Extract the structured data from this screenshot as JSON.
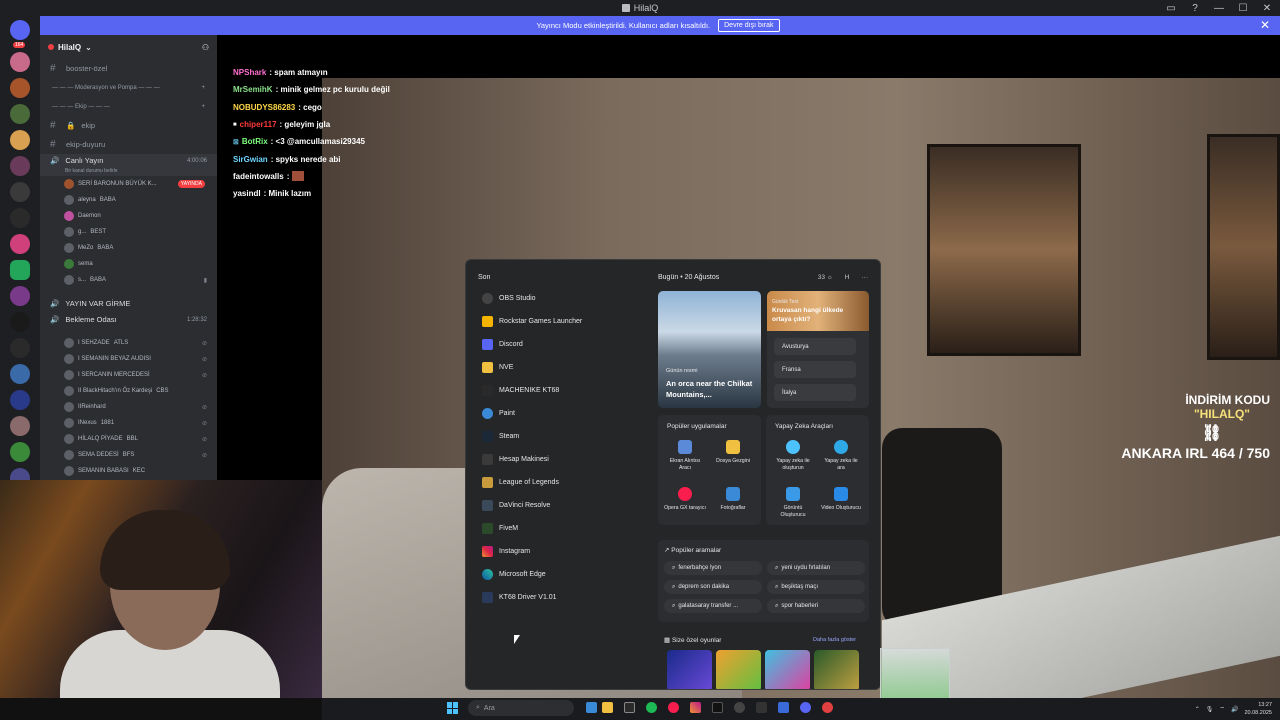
{
  "window": {
    "title": "HilalQ",
    "controls": [
      "▭",
      "?",
      "—",
      "☐",
      "✕"
    ]
  },
  "banner": {
    "text": "Yayıncı Modu etkinleştirildi. Kullanıcı adları kısaltıldı.",
    "button": "Devre dışı bırak"
  },
  "rail": {
    "badge": "164"
  },
  "sidebar": {
    "server_name": "HilalQ",
    "channels": [
      {
        "label": "booster-özel"
      }
    ],
    "cat_moderation": "Moderasyon ve Pompa",
    "cat_ekip": "Ekip",
    "ekip_channels": [
      "ekip",
      "ekip-duyuru"
    ],
    "voice1": {
      "name": "Canlı Yayın",
      "time": "4:00:06",
      "sub": "Bir kanal durumu belirle"
    },
    "voice1_users": [
      {
        "name": "SERİ BARONUN BÜYÜK K...",
        "tag": "YAYINDA"
      },
      {
        "name": "aleyna",
        "badge": "BABA"
      },
      {
        "name": "Daemon",
        "badge": ""
      },
      {
        "name": "g...",
        "badge": "BEST"
      },
      {
        "name": "MeZo",
        "badge": "BABA"
      },
      {
        "name": "sema",
        "badge": ""
      },
      {
        "name": "s...",
        "badge": "BABA"
      }
    ],
    "cat_yayin": "YAYIN VAR GİRME",
    "voice2": {
      "name": "Bekleme Odası",
      "time": "1:28:32"
    },
    "voice2_users": [
      {
        "name": "I SEHZADE",
        "badge": "ATLS"
      },
      {
        "name": "I SEMANIN BEYAZ AUDISI",
        "badge": ""
      },
      {
        "name": "I SERCANIN MERCEDESİ",
        "badge": ""
      },
      {
        "name": "II BlackHitach'ın Öz Kardeşi",
        "badge": "CBS"
      },
      {
        "name": "IIReinhard",
        "badge": ""
      },
      {
        "name": "INexus",
        "badge": "1881"
      },
      {
        "name": "HİLALQ PİYADE",
        "badge": "BBL"
      },
      {
        "name": "SEMA DEDESİ",
        "badge": "BFS"
      },
      {
        "name": "SEMANIN BABASI",
        "badge": "KEC"
      }
    ]
  },
  "chat": [
    {
      "user": "NPShark",
      "color": "#ff6fcf",
      "msg": ": spam atmayın"
    },
    {
      "user": "MrSemihK",
      "color": "#8be28b",
      "msg": ": minik gelmez pc kurulu değil"
    },
    {
      "user": "NOBUDYS86283",
      "color": "#ffd84a",
      "msg": ": cego"
    },
    {
      "user": "chiper117",
      "color": "#ff3b3b",
      "msg": ": geleyim jgla"
    },
    {
      "user": "BotRix",
      "color": "#7dff7d",
      "msg": ": <3 @amcullamasi29345"
    },
    {
      "user": "SirGwian",
      "color": "#6fd6ff",
      "msg": ": spyks nerede abi"
    },
    {
      "user": "fadeintowalls",
      "color": "#ffffff",
      "msg": ":"
    },
    {
      "user": "yasindl",
      "color": "#ffffff",
      "msg": ": Minik lazım"
    }
  ],
  "promo": {
    "line1": "İNDİRİM KODU",
    "line2": "\"HILALQ\"",
    "line3": "ANKARA IRL 464 / 750"
  },
  "start_menu": {
    "recent_header": "Son",
    "apps": [
      "OBS Studio",
      "Rockstar Games Launcher",
      "Discord",
      "NVE",
      "MACHENIKE KT68",
      "Paint",
      "Steam",
      "Hesap Makinesi",
      "League of Legends",
      "DaVinci Resolve",
      "FiveM",
      "Instagram",
      "Microsoft Edge",
      "KT68 Driver V1.01"
    ],
    "today": "Bugün",
    "date": "20 Ağustos",
    "weather": "33",
    "user_initial": "H",
    "photo_label": "Günün resmi",
    "photo_title": "An orca near the Chilkat Mountains,...",
    "quiz_tag": "Günlük Test",
    "quiz_question": "Kruvasan hangi ülkede ortaya çıktı?",
    "quiz_options": [
      "Avusturya",
      "Fransa",
      "İtalya"
    ],
    "popular_apps_title": "Popüler uygulamalar",
    "popular_apps": [
      "Ekran Alıntısı Aracı",
      "Dosya Gezgini",
      "Opera GX tarayıcı",
      "Fotoğraflar"
    ],
    "ai_title": "Yapay Zeka Araçları",
    "ai_tools": [
      "Yapay zeka ile oluşturun",
      "Yapay zeka ile ara",
      "Görüntü Oluşturucu",
      "Video Oluşturucu"
    ],
    "searches_title": "Popüler aramalar",
    "searches": [
      "fenerbahçe lyon",
      "yeni uydu fırlatılan",
      "deprem son dakika",
      "beşiktaş maçı",
      "galatasaray transfer ...",
      "spor haberleri"
    ],
    "games_title": "Size özel oyunlar",
    "games_more": "Daha fazla göster"
  },
  "taskbar": {
    "search_placeholder": "Ara",
    "time": "13:27",
    "date": "20.08.2025"
  }
}
